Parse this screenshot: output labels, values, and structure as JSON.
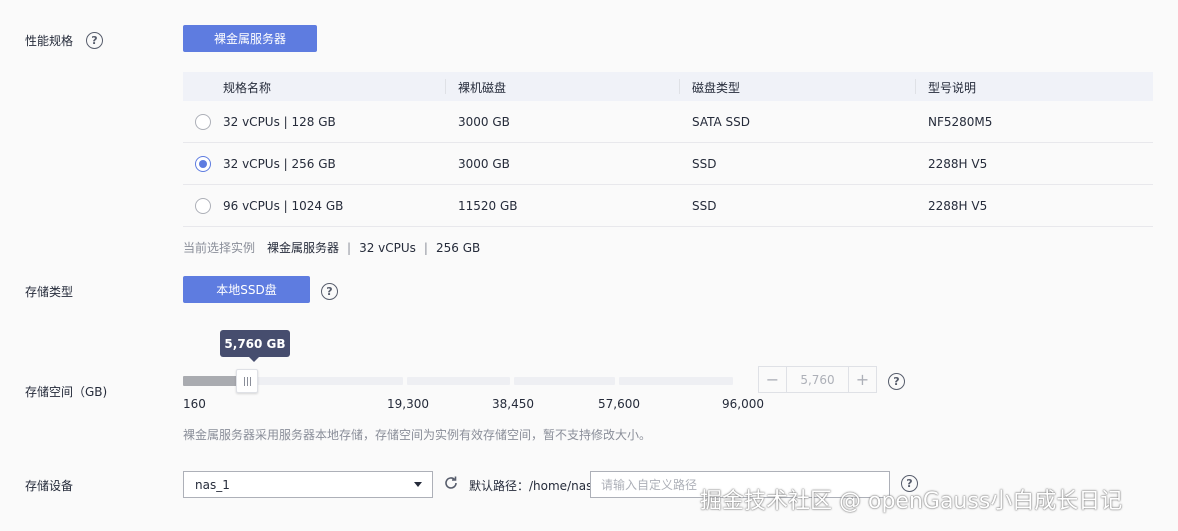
{
  "perf": {
    "label": "性能规格",
    "tab": "裸金属服务器",
    "columns": [
      "规格名称",
      "裸机磁盘",
      "磁盘类型",
      "型号说明"
    ],
    "rows": [
      {
        "spec": "32 vCPUs | 128 GB",
        "disk": "3000 GB",
        "type": "SATA SSD",
        "model": "NF5280M5",
        "selected": false
      },
      {
        "spec": "32 vCPUs | 256 GB",
        "disk": "3000 GB",
        "type": "SSD",
        "model": "2288H V5",
        "selected": true
      },
      {
        "spec": "96 vCPUs | 1024 GB",
        "disk": "11520 GB",
        "type": "SSD",
        "model": "2288H V5",
        "selected": false
      }
    ],
    "current": {
      "label": "当前选择实例",
      "kind": "裸金属服务器",
      "cpu": "32 vCPUs",
      "mem": "256 GB"
    }
  },
  "storage_type": {
    "label": "存储类型",
    "button": "本地SSD盘"
  },
  "storage_space": {
    "label": "存储空间（GB)",
    "tooltip": "5,760 GB",
    "value": 5760,
    "min": 160,
    "max": 96000,
    "ticks": [
      "160",
      "19,300",
      "38,450",
      "57,600",
      "96,000"
    ],
    "stepper_value": "5,760",
    "note": "裸金属服务器采用服务器本地存储，存储空间为实例有效存储空间，暂不支持修改大小。"
  },
  "storage_device": {
    "label": "存储设备",
    "selected": "nas_1",
    "path_label": "默认路径：/home/nas",
    "path_placeholder": "请输入自定义路径"
  },
  "watermark": "掘金技术社区 @ openGauss小白成长日记",
  "colors": {
    "primary": "#5e7ce0",
    "header_bg": "#f0f2f8",
    "tooltip_bg": "#464d6e"
  }
}
